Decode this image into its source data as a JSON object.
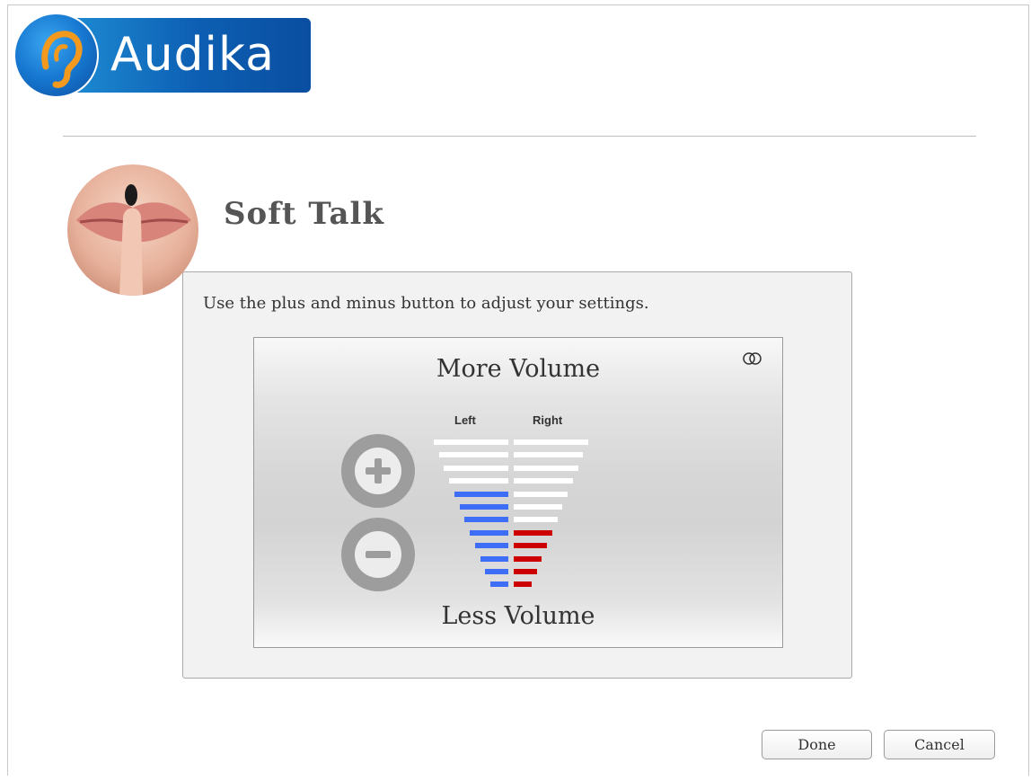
{
  "brand": {
    "name": "Audika"
  },
  "page": {
    "title": "Soft Talk"
  },
  "panel": {
    "instruction": "Use the plus and minus button to adjust your settings.",
    "volume": {
      "more_label": "More Volume",
      "less_label": "Less Volume",
      "left_label": "Left",
      "right_label": "Right",
      "total_levels": 12,
      "left_level": 8,
      "right_level": 5,
      "left_color": "#3d6ef5",
      "right_color": "#cc0000",
      "inactive_color": "#ffffff",
      "link_icon": "link-rings-icon"
    }
  },
  "buttons": {
    "done": "Done",
    "cancel": "Cancel"
  }
}
